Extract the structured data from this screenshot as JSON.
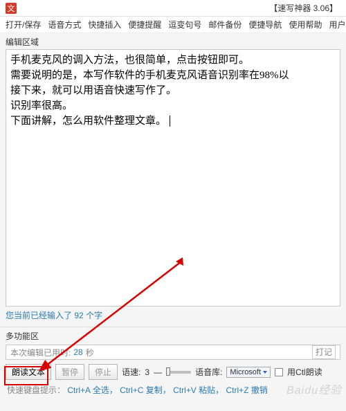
{
  "title": "【速写神器 3.06】",
  "app_icon_char": "文",
  "menu": {
    "open_save": "打开/保存",
    "voice_mode": "语音方式",
    "quick_insert": "快捷插入",
    "handy_reminder": "便捷提醒",
    "sentence_change": "逗变句号",
    "mail_backup": "邮件备份",
    "handy_nav": "便捷导航",
    "usage_help": "使用帮助",
    "user_center": "用户中心"
  },
  "editor": {
    "section_label": "编辑区域",
    "content": "手机麦克风的调入方法，也很简单，点击按钮即可。\n需要说明的是，本写作软件的手机麦克风语音识别率在98%以\n接下来，就可以用语音快速写作了。\n识别率很高。\n下面讲解，怎么用软件整理文章。"
  },
  "status": {
    "prefix": "您当前已经输入了",
    "count": "92",
    "suffix": "个字"
  },
  "multi": {
    "label": "多功能区",
    "timer_prefix": "本次编辑已用时:",
    "timer_value": "28",
    "timer_unit": "秒"
  },
  "controls": {
    "read_text": "朗读文本",
    "pause": "暂停",
    "stop": "停止",
    "speed_label": "语速:",
    "speed_value": "3",
    "voice_library_label": "语音库:",
    "voice_library_value": "Microsoft",
    "checkbox_label": "用Ctl朗读",
    "rt_placeholder": "打记"
  },
  "hints": {
    "prefix": "快速键盘提示：",
    "k1": "Ctrl+A",
    "v1": "全选，",
    "k2": "Ctrl+C",
    "v2": "复制，",
    "k3": "Ctrl+V",
    "v3": "粘贴，",
    "k4": "Ctrl+Z",
    "v4": "撤销"
  },
  "watermark": "Baidu经验"
}
